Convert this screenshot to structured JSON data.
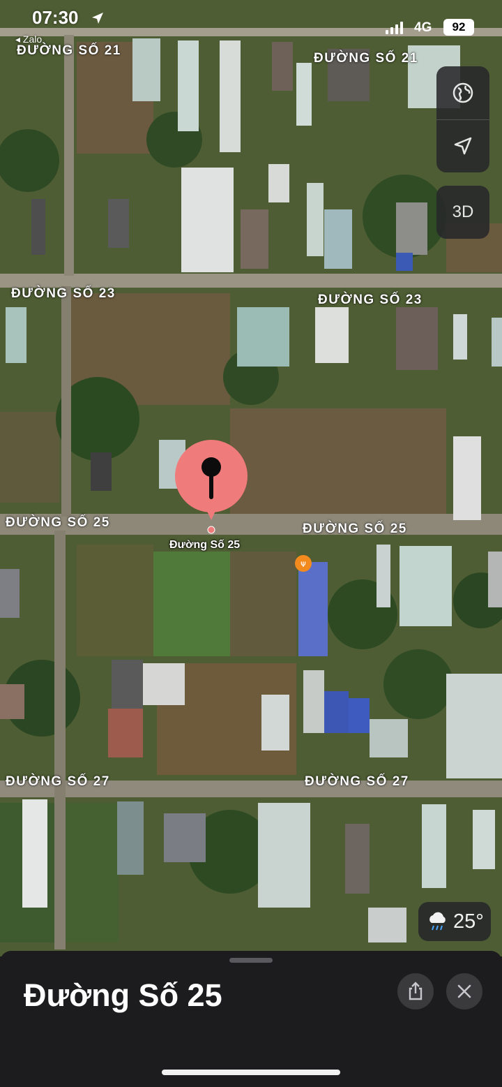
{
  "status_bar": {
    "time": "07:30",
    "back_app": "◂ Zalo",
    "network": "4G",
    "battery": "92"
  },
  "map": {
    "roads": {
      "r21_left": "ĐƯỜNG SỐ 21",
      "r21_right": "ĐƯỜNG SỐ 21",
      "r23_left": "ĐƯỜNG SỐ 23",
      "r23_right": "ĐƯỜNG SỐ 23",
      "r25_left": "ĐƯỜNG SỐ 25",
      "r25_right": "ĐƯỜNG SỐ 25",
      "r27_left": "ĐƯỜNG SỐ 27",
      "r27_right": "ĐƯỜNG SỐ 27"
    },
    "pin_label": "Đường Số 25",
    "pin_color": "#f07b7b",
    "poi_color": "#f28a1e"
  },
  "controls": {
    "map_mode_icon": "globe-icon",
    "locate_icon": "location-arrow-icon",
    "view_3d": "3D"
  },
  "weather": {
    "icon": "rain-cloud-icon",
    "temp": "25°"
  },
  "sheet": {
    "title": "Đường Số 25",
    "share_icon": "share-icon",
    "close_icon": "close-icon"
  }
}
